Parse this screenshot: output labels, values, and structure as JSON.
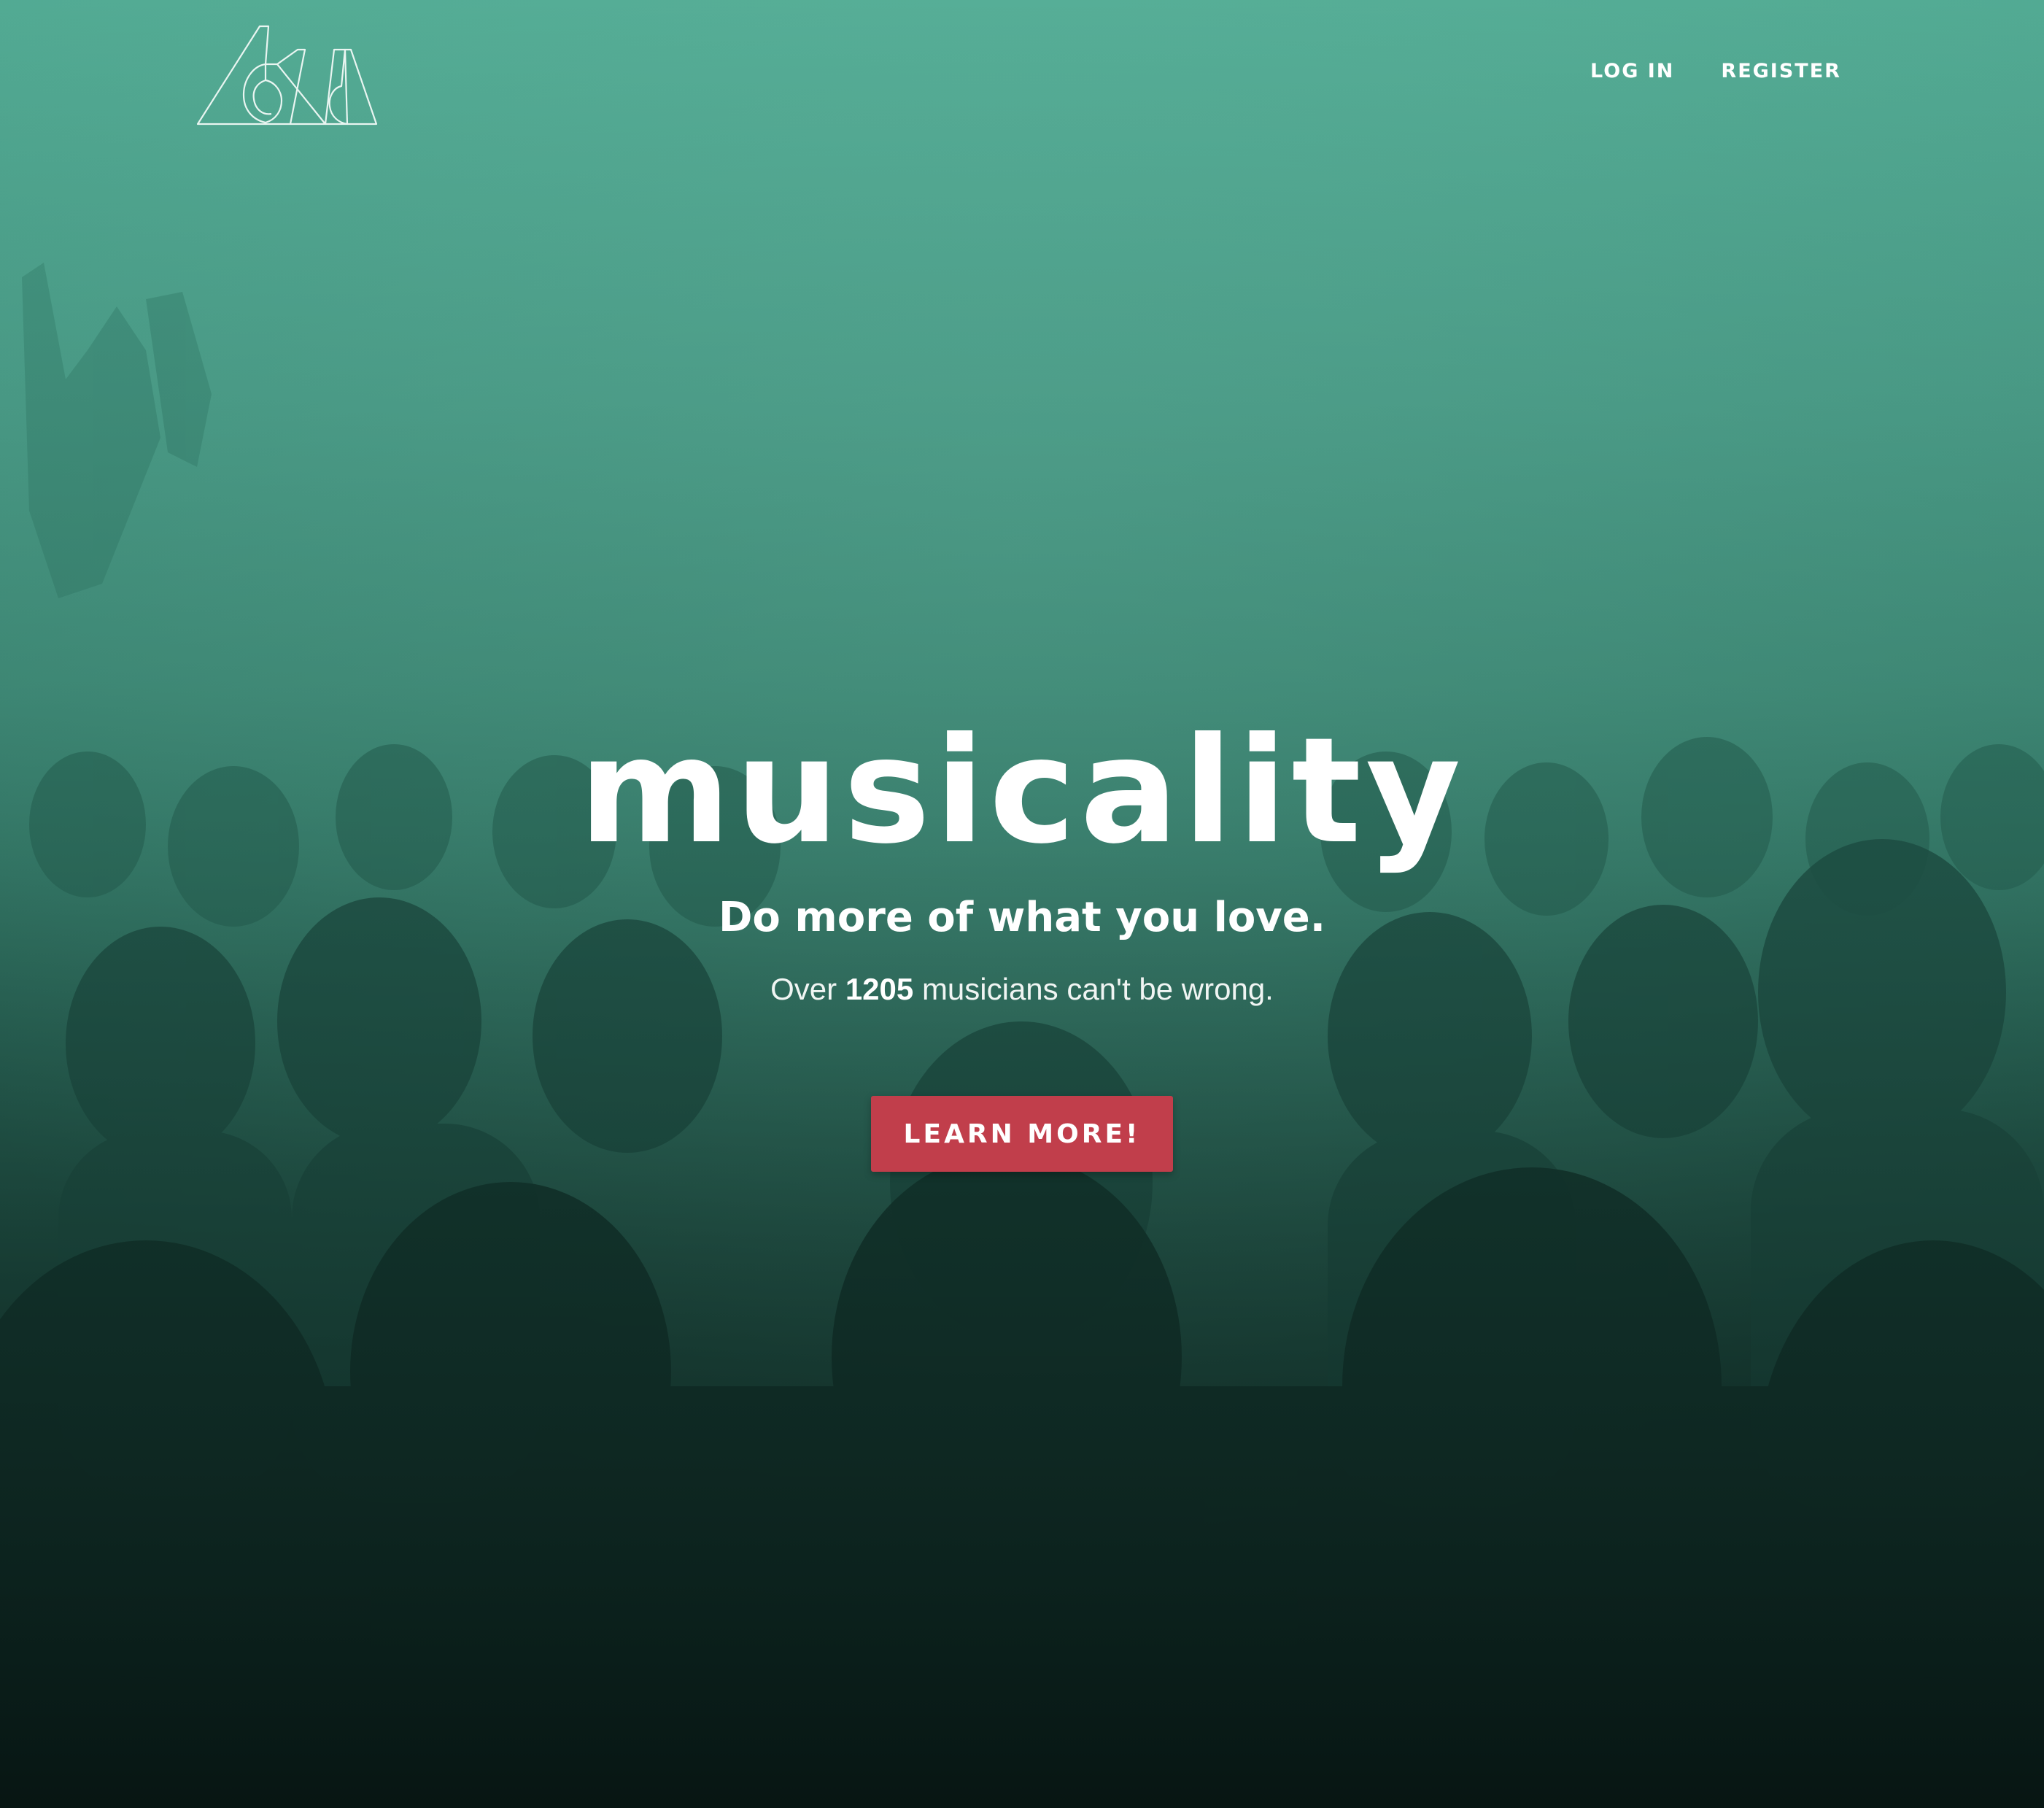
{
  "nav": {
    "login_label": "LOG IN",
    "register_label": "REGISTER"
  },
  "hero": {
    "brand_name": "musicality",
    "tagline": "Do more of what you love.",
    "sub_prefix": "Over",
    "musician_count": "1205",
    "sub_suffix": "musicians can't be wrong.",
    "cta_label": "LEARN MORE!"
  },
  "colors": {
    "teal_overlay": "#52aa93",
    "cta_red": "#c13e4b",
    "text_white": "#ffffff"
  }
}
